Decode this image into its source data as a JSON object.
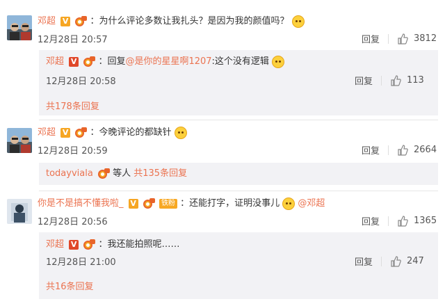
{
  "comments": [
    {
      "user": "邓超",
      "text": "：为什么评论多数让我扎头？是因为我的颜值吗？",
      "time": "12月28日 20:57",
      "reply_label": "回复",
      "likes": "3812",
      "replies": [
        {
          "user": "邓超",
          "prefix": "：回复",
          "mention": "@是你的星星啊1207",
          "text": ":这个没有逻辑",
          "time": "12月28日 20:58",
          "reply_label": "回复",
          "likes": "113"
        }
      ],
      "more": "共178条回复"
    },
    {
      "user": "邓超",
      "text": "：今晚评论的都缺针",
      "time": "12月28日 20:59",
      "reply_label": "回复",
      "likes": "2664",
      "summary_user": "todayviala",
      "summary_text": "等人",
      "summary_more": "共135条回复"
    },
    {
      "user": "你是不是搞不懂我啦_",
      "fans_tag": "铁粉",
      "text": "：还能打字，证明没事儿",
      "mention": "@邓超",
      "time": "12月28日 20:56",
      "reply_label": "回复",
      "likes": "1365",
      "replies": [
        {
          "user": "邓超",
          "text": "：我还能拍照呢……",
          "time": "12月28日 21:00",
          "reply_label": "回复",
          "likes": "247"
        }
      ],
      "more": "共16条回复"
    }
  ]
}
